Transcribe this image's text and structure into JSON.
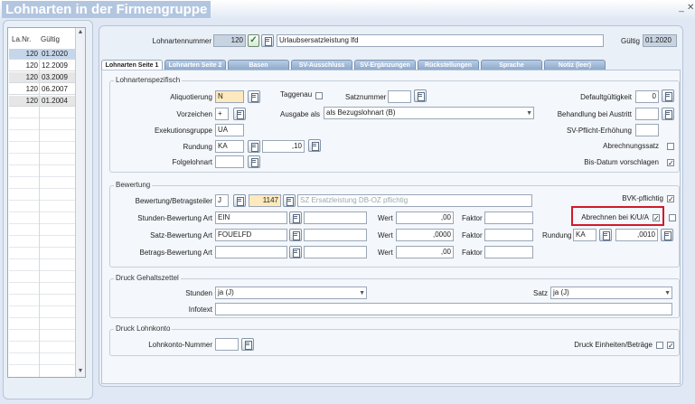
{
  "window": {
    "title": "Lohnarten in der Firmengruppe",
    "btn_min": "_",
    "btn_close": "✕"
  },
  "list": {
    "col_nr": "La.Nr.",
    "col_gueltig": "Gültig",
    "rows": [
      {
        "nr": "120",
        "date": "01.2020"
      },
      {
        "nr": "120",
        "date": "12.2009"
      },
      {
        "nr": "120",
        "date": "03.2009"
      },
      {
        "nr": "120",
        "date": "06.2007"
      },
      {
        "nr": "120",
        "date": "01.2004"
      }
    ]
  },
  "header": {
    "lohnartennummer_label": "Lohnartennummer",
    "lohnartennummer": "120",
    "name": "Urlaubsersatzleistung lfd",
    "gueltig_label": "Gültig",
    "gueltig": "01.2020"
  },
  "tabs": [
    "Lohnarten Seite 1",
    "Lohnarten Seite 2",
    "Basen",
    "SV-Ausschluss",
    "SV-Ergänzungen",
    "Rückstellungen",
    "Sprache",
    "Notiz (leer)"
  ],
  "lohnartenspezifisch": {
    "title": "Lohnartenspezifisch",
    "aliquotierung_label": "Aliquotierung",
    "aliquotierung": "N",
    "taggenau_label": "Taggenau",
    "satznummer_label": "Satznummer",
    "satznummer": "",
    "defaultgueltigkeit_label": "Defaultgültigkeit",
    "defaultgueltigkeit": "0",
    "vorzeichen_label": "Vorzeichen",
    "vorzeichen": "+",
    "ausgabe_label": "Ausgabe als",
    "ausgabe": "als Bezugslohnart (B)",
    "behandlung_label": "Behandlung bei Austritt",
    "behandlung": "",
    "exekution_label": "Exekutionsgruppe",
    "exekution": "UA",
    "svpflicht_label": "SV-Pflicht-Erhöhung",
    "svpflicht": "",
    "rundung_label": "Rundung",
    "rundung": "KA",
    "rundung_val": ",10",
    "abrechnungssatz_label": "Abrechnungssatz",
    "folgelohnart_label": "Folgelohnart",
    "folgelohnart": "",
    "bisdatum_label": "Bis-Datum vorschlagen",
    "bisdatum_check": "✓"
  },
  "bewertung": {
    "title": "Bewertung",
    "betragsteiler_label": "Bewertung/Betragsteiler",
    "betragsteiler": "J",
    "betragsteiler_num": "1147",
    "betragsteiler_text": "SZ Ersatzleistung DB-OZ pflichtig",
    "bvk_label": "BVK-pflichtig",
    "bvk_check": "✓",
    "stunden_label": "Stunden-Bewertung Art",
    "stunden": "EIN",
    "stunden_wert": ",00",
    "abrechnen_label": "Abrechnen bei K/U/A",
    "abrechnen_check": "✓",
    "satz_label": "Satz-Bewertung Art",
    "satz": "FOUELFD",
    "satz_wert": ",0000",
    "rundung_label": "Rundung",
    "rundung": "KA",
    "rundung_val": ",0010",
    "betrags_label": "Betrags-Bewertung Art",
    "betrags": "",
    "betrags_wert": ",00",
    "wert_label": "Wert",
    "faktor_label": "Faktor"
  },
  "gehaltszettel": {
    "title": "Druck Gehaltszettel",
    "stunden_label": "Stunden",
    "stunden": "ja (J)",
    "satz_label": "Satz",
    "satz": "ja (J)",
    "infotext_label": "Infotext",
    "infotext": ""
  },
  "lohnkonto": {
    "title": "Druck Lohnkonto",
    "nummer_label": "Lohnkonto-Nummer",
    "nummer": "",
    "einheiten_label": "Druck Einheiten/Beträge",
    "einheiten_check": "✓"
  },
  "icons": {
    "check": "✓",
    "dropdown": "▼",
    "scroll_up": "▲",
    "scroll_down": "▼"
  }
}
